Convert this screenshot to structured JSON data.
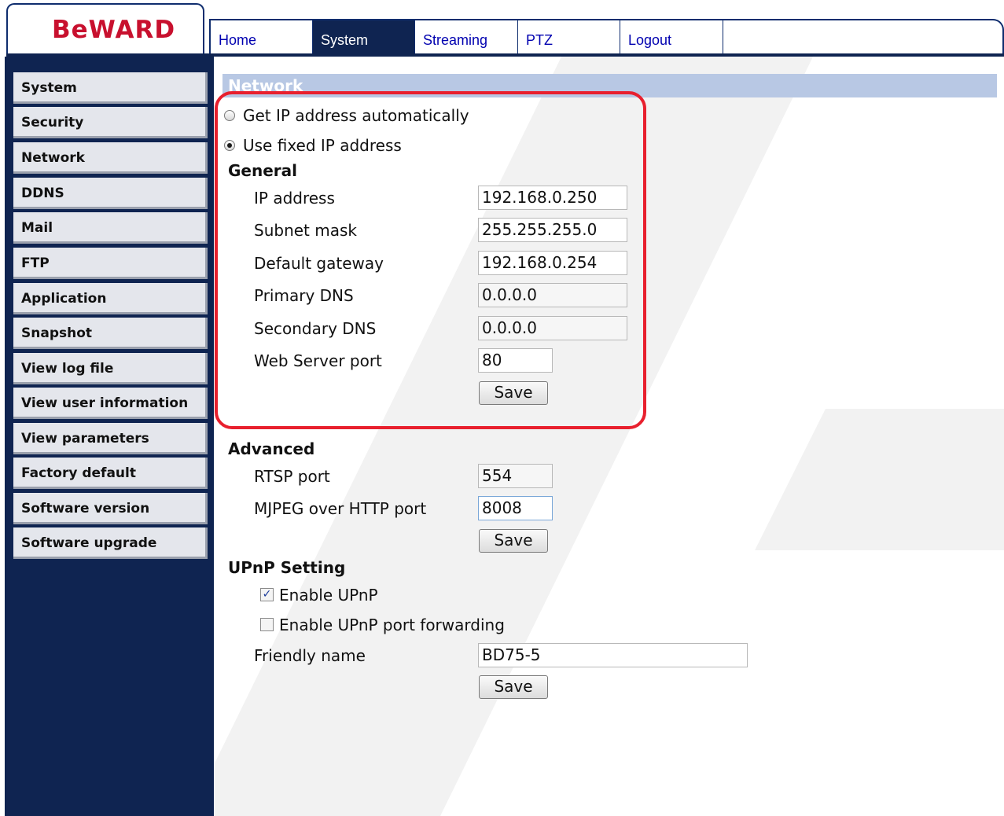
{
  "header": {
    "logo_text": "BeWARD",
    "tabs": [
      {
        "label": "Home"
      },
      {
        "label": "System"
      },
      {
        "label": "Streaming"
      },
      {
        "label": "PTZ"
      },
      {
        "label": "Logout"
      }
    ],
    "active_tab": "System"
  },
  "sidebar": {
    "items": [
      {
        "label": "System"
      },
      {
        "label": "Security"
      },
      {
        "label": "Network"
      },
      {
        "label": "DDNS"
      },
      {
        "label": "Mail"
      },
      {
        "label": "FTP"
      },
      {
        "label": "Application"
      },
      {
        "label": "Snapshot"
      },
      {
        "label": "View log file"
      },
      {
        "label": "View user information"
      },
      {
        "label": "View parameters"
      },
      {
        "label": "Factory default"
      },
      {
        "label": "Software version"
      },
      {
        "label": "Software upgrade"
      }
    ]
  },
  "main": {
    "section_title": "Network",
    "ip_mode": {
      "auto_label": "Get IP address automatically",
      "fixed_label": "Use fixed IP address",
      "selected": "fixed"
    },
    "general": {
      "heading": "General",
      "ip_address_label": "IP address",
      "ip_address_value": "192.168.0.250",
      "subnet_mask_label": "Subnet mask",
      "subnet_mask_value": "255.255.255.0",
      "default_gateway_label": "Default gateway",
      "default_gateway_value": "192.168.0.254",
      "primary_dns_label": "Primary DNS",
      "primary_dns_value": "0.0.0.0",
      "secondary_dns_label": "Secondary DNS",
      "secondary_dns_value": "0.0.0.0",
      "web_port_label": "Web Server port",
      "web_port_value": "80",
      "save_label": "Save"
    },
    "advanced": {
      "heading": "Advanced",
      "rtsp_label": "RTSP port",
      "rtsp_value": "554",
      "mjpeg_label": "MJPEG over HTTP port",
      "mjpeg_value": "8008",
      "save_label": "Save"
    },
    "upnp": {
      "heading": "UPnP Setting",
      "enable_upnp_label": "Enable UPnP",
      "enable_upnp_checked": true,
      "port_forwarding_label": "Enable UPnP port forwarding",
      "port_forwarding_checked": false,
      "friendly_name_label": "Friendly name",
      "friendly_name_value": "BD75-5",
      "save_label": "Save"
    }
  },
  "colors": {
    "navy": "#0f2451",
    "section_bar": "#b8c8e4",
    "highlight": "#e8202e",
    "logo": "#c8102e"
  }
}
